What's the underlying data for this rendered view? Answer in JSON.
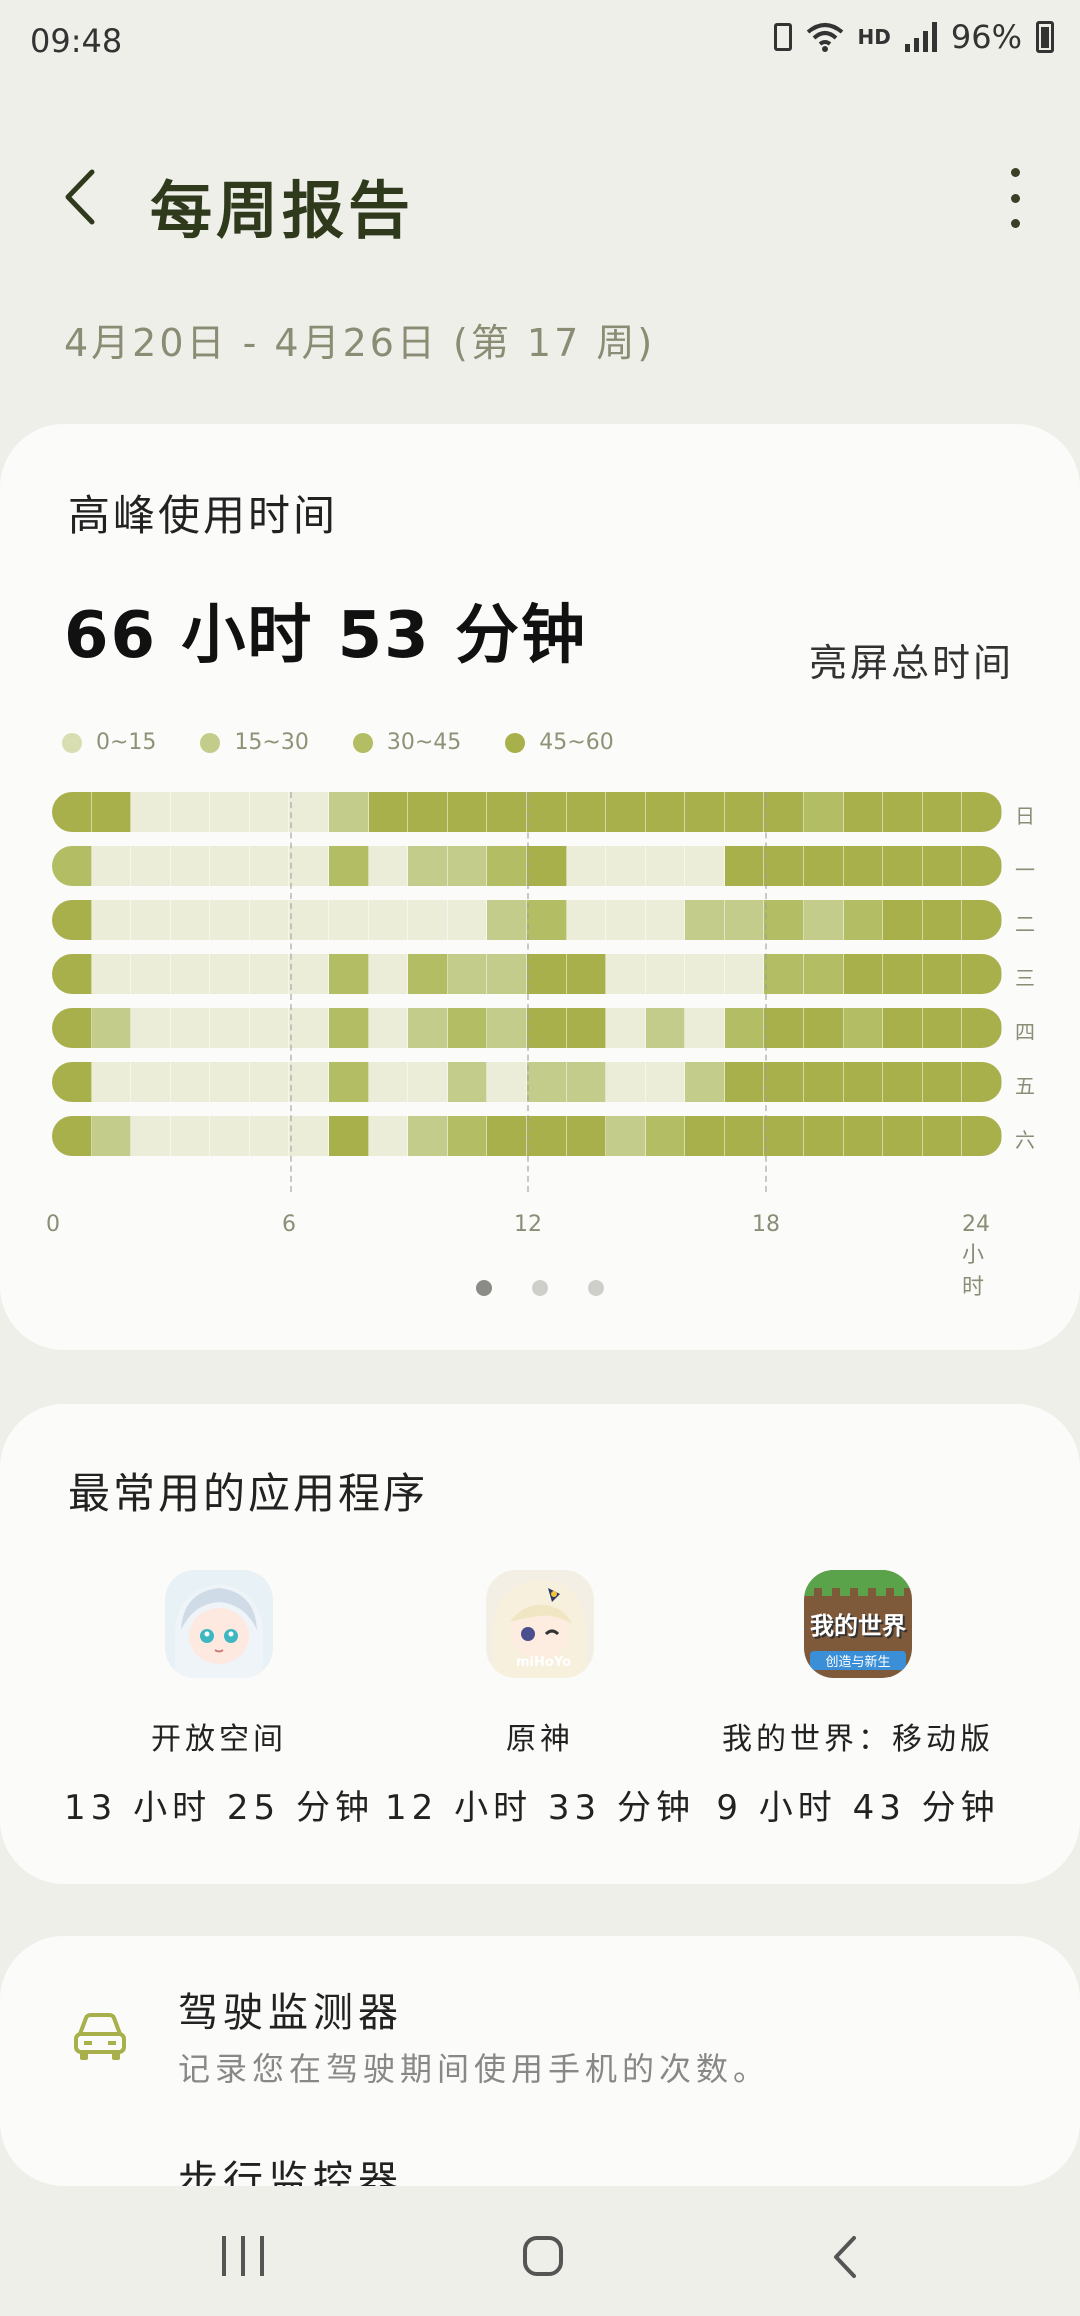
{
  "status_bar": {
    "time": "09:48",
    "network": "HD",
    "battery": "96%"
  },
  "header": {
    "title": "每周报告",
    "date_range": "4月20日 - 4月26日 (第 17 周)"
  },
  "peak_card": {
    "title": "高峰使用时间",
    "total_time": "66 小时 53 分钟",
    "total_label": "亮屏总时间",
    "legend": [
      {
        "label": "0~15",
        "color": "#d8ddb2"
      },
      {
        "label": "15~30",
        "color": "#c4cc8c"
      },
      {
        "label": "30~45",
        "color": "#b2bd64"
      },
      {
        "label": "45~60",
        "color": "#a7b04a"
      }
    ],
    "days": [
      "日",
      "一",
      "二",
      "三",
      "四",
      "五",
      "六"
    ],
    "x_ticks": [
      "0",
      "6",
      "12",
      "18",
      "24小时"
    ],
    "page_count": 3,
    "active_page": 0
  },
  "chart_data": {
    "type": "heatmap",
    "rows": [
      "日",
      "一",
      "二",
      "三",
      "四",
      "五",
      "六"
    ],
    "x": [
      0,
      1,
      2,
      3,
      4,
      5,
      6,
      7,
      8,
      9,
      10,
      11,
      12,
      13,
      14,
      15,
      16,
      17,
      18,
      19,
      20,
      21,
      22,
      23
    ],
    "xlabel": "小时",
    "levels": [
      "0~15",
      "15~30",
      "30~45",
      "45~60"
    ],
    "values": [
      [
        3,
        3,
        0,
        0,
        0,
        0,
        0,
        1,
        3,
        3,
        3,
        3,
        3,
        3,
        3,
        3,
        3,
        3,
        3,
        2,
        3,
        3,
        3,
        3
      ],
      [
        2,
        0,
        0,
        0,
        0,
        0,
        0,
        2,
        0,
        1,
        1,
        2,
        3,
        0,
        0,
        0,
        0,
        3,
        3,
        3,
        3,
        3,
        3,
        3
      ],
      [
        3,
        0,
        0,
        0,
        0,
        0,
        0,
        0,
        0,
        0,
        0,
        1,
        2,
        0,
        0,
        0,
        1,
        1,
        2,
        1,
        2,
        3,
        3,
        3
      ],
      [
        3,
        0,
        0,
        0,
        0,
        0,
        0,
        2,
        0,
        2,
        1,
        1,
        3,
        3,
        0,
        0,
        0,
        0,
        2,
        2,
        3,
        3,
        3,
        3
      ],
      [
        3,
        1,
        0,
        0,
        0,
        0,
        0,
        2,
        0,
        1,
        2,
        1,
        3,
        3,
        0,
        1,
        0,
        2,
        3,
        3,
        2,
        3,
        3,
        3
      ],
      [
        3,
        0,
        0,
        0,
        0,
        0,
        0,
        2,
        0,
        0,
        1,
        0,
        1,
        1,
        0,
        0,
        1,
        3,
        3,
        3,
        3,
        3,
        3,
        3
      ],
      [
        3,
        1,
        0,
        0,
        0,
        0,
        0,
        3,
        0,
        1,
        2,
        3,
        3,
        3,
        1,
        2,
        3,
        3,
        3,
        3,
        3,
        3,
        3,
        3
      ]
    ]
  },
  "apps_card": {
    "title": "最常用的应用程序",
    "apps": [
      {
        "name": "开放空间",
        "duration": "13 小时 25 分钟",
        "icon": "open-space-icon"
      },
      {
        "name": "原神",
        "duration": "12 小时 33 分钟",
        "icon": "genshin-icon",
        "icon_text": "miHoYo"
      },
      {
        "name": "我的世界：移动版",
        "duration": "9 小时 43 分钟",
        "icon": "minecraft-icon",
        "icon_text": "我的世界",
        "icon_subtext": "创造与新生"
      }
    ]
  },
  "driving_card": {
    "title": "驾驶监测器",
    "description": "记录您在驾驶期间使用手机的次数。",
    "next_title": "步行监控器"
  },
  "colors": {
    "empty_cell": "#ecedd9",
    "accent": "#a7b04a",
    "title": "#2f3a1d"
  }
}
